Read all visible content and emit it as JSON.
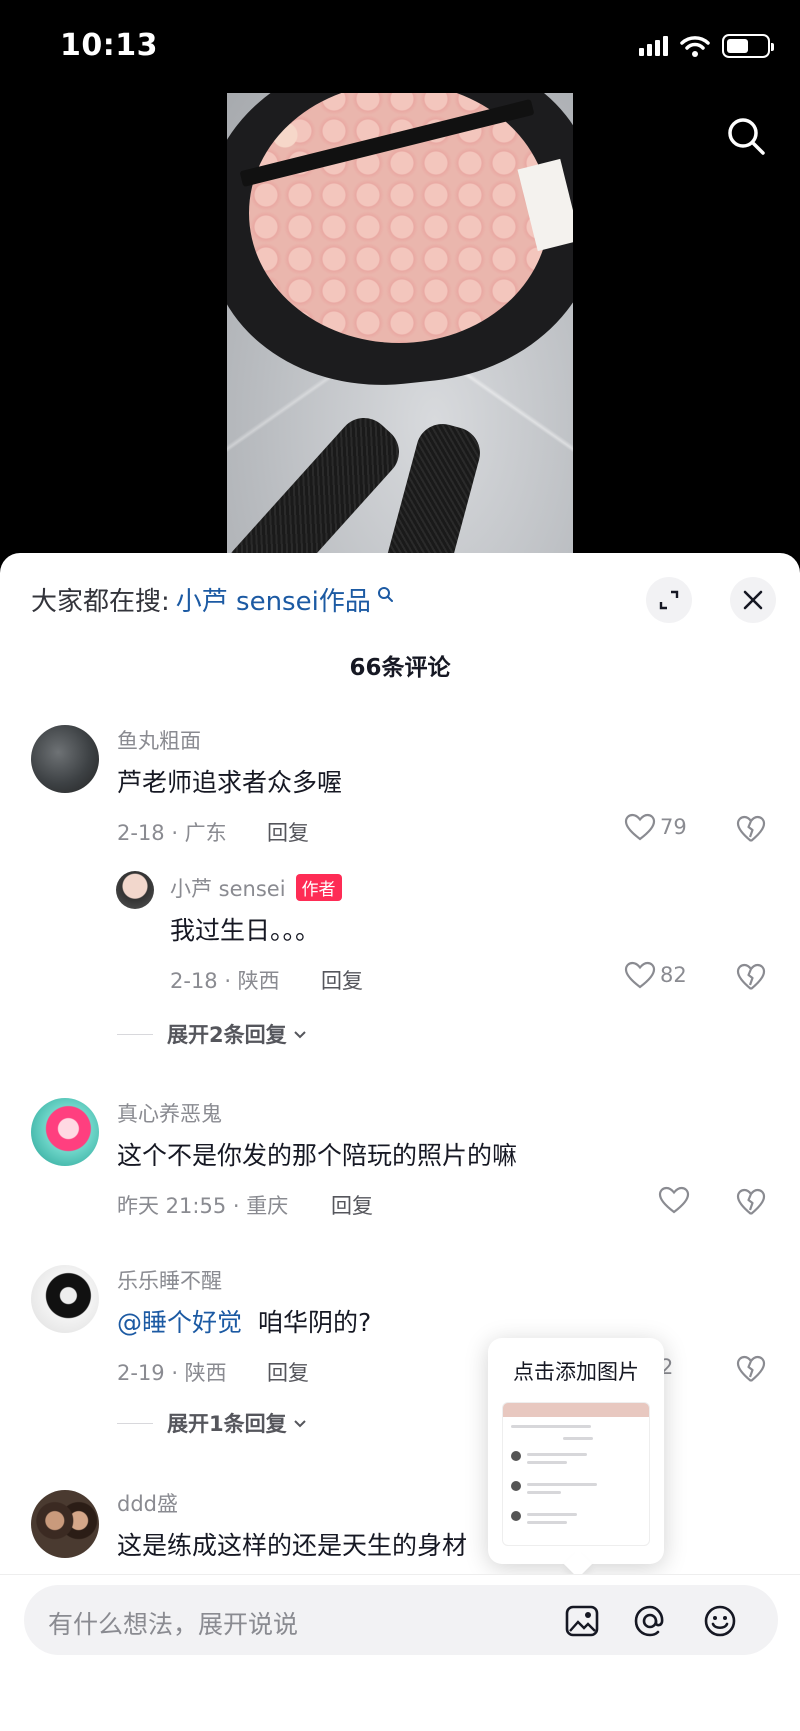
{
  "status_bar": {
    "time": "10:13",
    "battery_level": 0.55
  },
  "sheet": {
    "hot_search_label": "大家都在搜:",
    "hot_search_term": "小芦 sensei作品",
    "comment_count": "66条评论"
  },
  "comments": [
    {
      "name": "鱼丸粗面",
      "text": "芦老师追求者众多喔",
      "meta": "2-18 · 广东",
      "reply": "回复",
      "likes": "79"
    },
    {
      "name": "小芦 sensei",
      "tag": "作者",
      "text": "我过生日。。。",
      "meta": "2-18 · 陕西",
      "reply": "回复",
      "likes": "82"
    },
    {
      "expand": "展开2条回复"
    },
    {
      "name": "真心养恶鬼",
      "text": "这个不是你发的那个陪玩的照片的嘛",
      "meta": "昨天 21:55 · 重庆",
      "reply": "回复",
      "likes": ""
    },
    {
      "name": "乐乐睡不醒",
      "mention": "@睡个好觉",
      "text": "咱华阴的?",
      "meta": "2-19 · 陕西",
      "reply": "回复",
      "likes": "2"
    },
    {
      "expand": "展开1条回复"
    },
    {
      "name": "ddd盛",
      "text": "这是练成这样的还是天生的身材",
      "meta": "",
      "reply": "",
      "likes": ""
    }
  ],
  "tooltip": {
    "title": "点击添加图片"
  },
  "composer": {
    "placeholder": "有什么想法，展开说说"
  },
  "colors": {
    "accent": "#fe2c55",
    "link": "#1c5aa3",
    "muted": "#8a8b91"
  }
}
